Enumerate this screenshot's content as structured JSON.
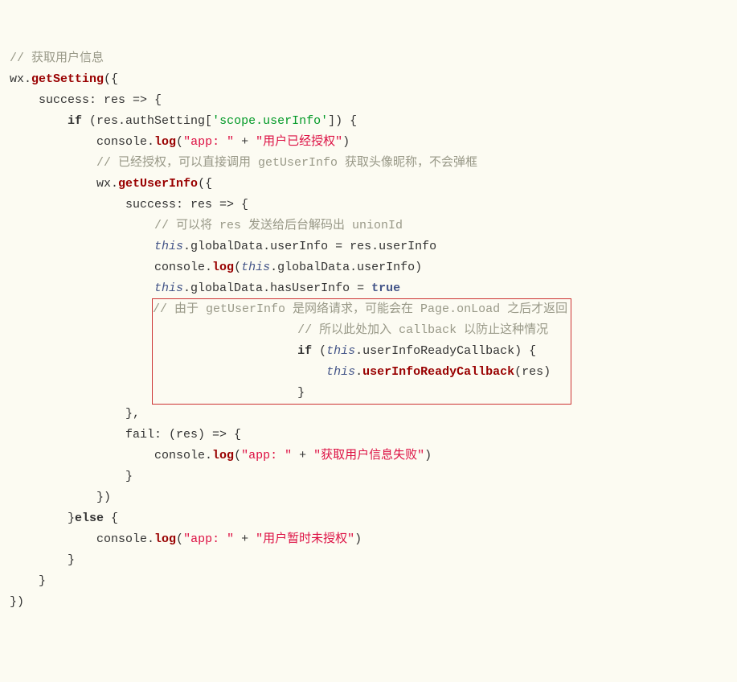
{
  "code": {
    "c1": "// 获取用户信息",
    "l2a": "wx.",
    "l2b": "getSetting",
    "l2c": "({",
    "l3a": "    success: res => {",
    "l4a": "        ",
    "l4b": "if",
    "l4c": " (res.authSetting[",
    "l4d": "'scope.userInfo'",
    "l4e": "]) {",
    "l5a": "            console.",
    "l5b": "log",
    "l5c": "(",
    "l5d": "\"app: \"",
    "l5e": " + ",
    "l5f": "\"用户已经授权\"",
    "l5g": ")",
    "c6": "            // 已经授权，可以直接调用 getUserInfo 获取头像昵称，不会弹框",
    "l7a": "            wx.",
    "l7b": "getUserInfo",
    "l7c": "({",
    "l8a": "                success: res => {",
    "c9": "                    // 可以将 res 发送给后台解码出 unionId",
    "l10a": "                    ",
    "l10b": "this",
    "l10c": ".globalData.userInfo = res.userInfo",
    "l11a": "                    console.",
    "l11b": "log",
    "l11c": "(",
    "l11d": "this",
    "l11e": ".globalData.userInfo)",
    "l12a": "                    ",
    "l12b": "this",
    "l12c": ".globalData.hasUserInfo = ",
    "l12d": "true",
    "hlpad": "                    ",
    "hc1": "// 由于 getUserInfo 是网络请求，可能会在 Page.onLoad 之后才返回",
    "hc2": "// 所以此处加入 callback 以防止这种情况",
    "h3a": "if",
    "h3b": " (",
    "h3c": "this",
    "h3d": ".userInfoReadyCallback) {",
    "h4a": "    ",
    "h4b": "this",
    "h4c": ".",
    "h4d": "userInfoReadyCallback",
    "h4e": "(res)",
    "h5": "}",
    "l14": "                },",
    "l15a": "                fail: (res) => {",
    "l16a": "                    console.",
    "l16b": "log",
    "l16c": "(",
    "l16d": "\"app: \"",
    "l16e": " + ",
    "l16f": "\"获取用户信息失败\"",
    "l16g": ")",
    "l17": "                }",
    "l18": "            })",
    "l19a": "        }",
    "l19b": "else",
    "l19c": " {",
    "l20a": "            console.",
    "l20b": "log",
    "l20c": "(",
    "l20d": "\"app: \"",
    "l20e": " + ",
    "l20f": "\"用户暂时未授权\"",
    "l20g": ")",
    "l21": "        }",
    "l22": "    }",
    "l23": "})"
  }
}
